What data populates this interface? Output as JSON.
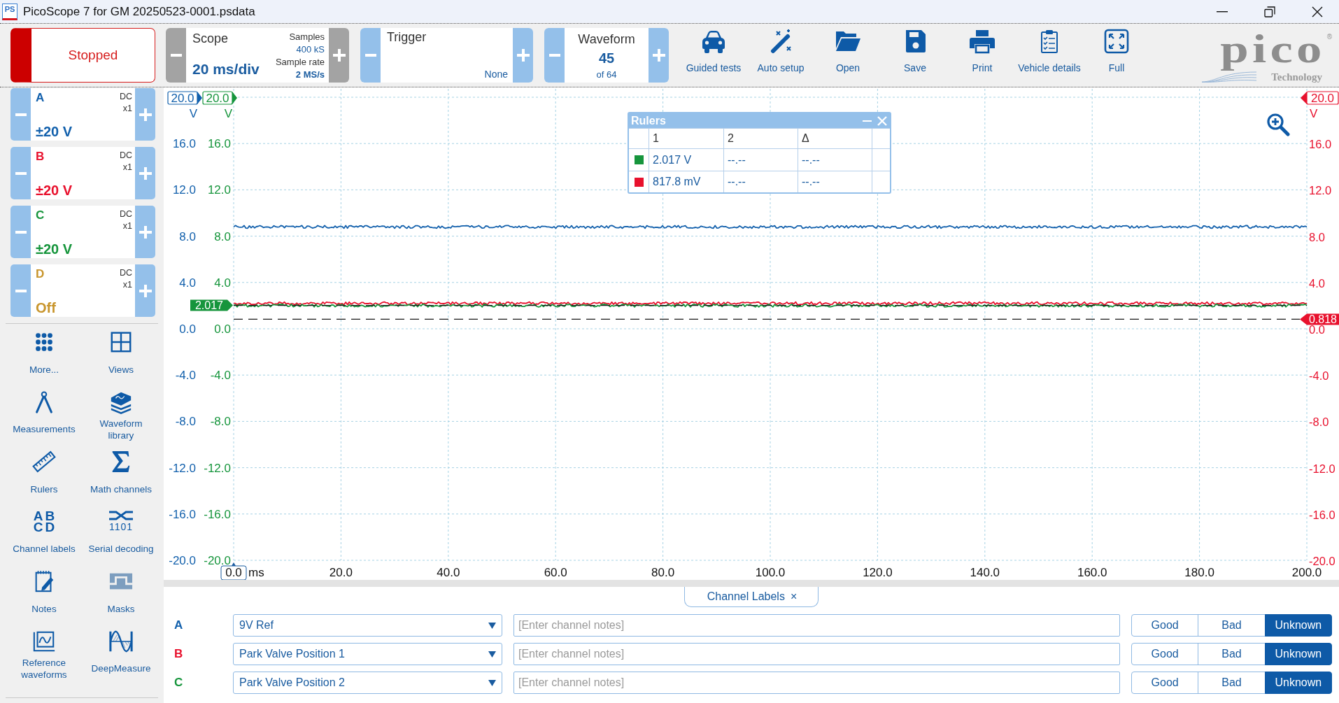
{
  "window": {
    "icon_letters": "PS",
    "title": "PicoScope 7 for GM 20250523-0001.psdata"
  },
  "toolbar": {
    "run_button": {
      "label": "Stopped",
      "running": false
    },
    "timebase": {
      "label": "Scope",
      "value": "20 ms/div",
      "samples_label": "Samples",
      "samples": "400 kS",
      "rate_label": "Sample rate",
      "rate": "2 MS/s"
    },
    "trigger": {
      "label": "Trigger",
      "mode": "None"
    },
    "waveform": {
      "label": "Waveform",
      "current": "45",
      "total": "of 64"
    },
    "buttons": [
      {
        "label": "Guided tests"
      },
      {
        "label": "Auto setup"
      },
      {
        "label": "Open"
      },
      {
        "label": "Save"
      },
      {
        "label": "Print"
      },
      {
        "label": "Vehicle details"
      },
      {
        "label": "Full"
      }
    ]
  },
  "logo": {
    "wordmark": "pico",
    "mark": "®",
    "tagline": "Technology"
  },
  "channels": [
    {
      "name": "A",
      "color": "#1260ac",
      "coupling": "DC",
      "probe": "x1",
      "range": "±20 V"
    },
    {
      "name": "B",
      "color": "#e8112d",
      "coupling": "DC",
      "probe": "x1",
      "range": "±20 V"
    },
    {
      "name": "C",
      "color": "#16953c",
      "coupling": "DC",
      "probe": "x1",
      "range": "±20 V"
    },
    {
      "name": "D",
      "color": "#c8952c",
      "coupling": "DC",
      "probe": "x1",
      "range": "Off"
    }
  ],
  "tools": [
    {
      "label": "More..."
    },
    {
      "label": "Views"
    },
    {
      "label": "Measurements"
    },
    {
      "label": "Waveform library"
    },
    {
      "label": "Rulers"
    },
    {
      "label": "Math channels"
    },
    {
      "label": "Channel labels",
      "glyph": [
        "AB",
        "CD"
      ]
    },
    {
      "label": "Serial decoding",
      "glyph": [
        "1101"
      ]
    },
    {
      "label": "Notes"
    },
    {
      "label": "Masks"
    },
    {
      "label": "Reference waveforms"
    },
    {
      "label": "DeepMeasure"
    }
  ],
  "chart": {
    "left_axes": [
      {
        "color": "#1260ac",
        "unit": "V"
      },
      {
        "color": "#16953c",
        "unit": "V",
        "tick_labels": [
          "20.0",
          "16.0",
          "12.0",
          "8.0",
          "4.0",
          "0.0",
          "-4.0",
          "-8.0",
          "-12.0",
          "-16.0",
          "-20.0"
        ]
      }
    ],
    "right_axes": [
      {
        "color": "#e8112d",
        "unit": "V",
        "tick_labels": [
          "20.0",
          "16.0",
          "12.0",
          "8.0",
          "4.0",
          "0.0",
          "-4.0",
          "-8.0",
          "-12.0",
          "-16.0",
          "-20.0"
        ]
      }
    ],
    "chart_data": {
      "type": "line",
      "x": [
        0,
        200
      ],
      "series": [
        {
          "color": "#1260ac",
          "values": [
            8.8,
            8.8
          ]
        },
        {
          "color": "#e8112d",
          "values": [
            2.2,
            2.2
          ]
        },
        {
          "color": "#16953c",
          "values": [
            2.0,
            2.0
          ]
        }
      ],
      "xlabel": "ms",
      "xlim": [
        0,
        200
      ],
      "ylim": [
        -20,
        20
      ],
      "grid": true,
      "xticks": [
        {
          "value": 0,
          "label": "0.0"
        },
        {
          "value": 20,
          "label": "20.0"
        },
        {
          "value": 40,
          "label": "40.0"
        },
        {
          "value": 60,
          "label": "60.0"
        },
        {
          "value": 80,
          "label": "80.0"
        },
        {
          "value": 100,
          "label": "100.0"
        },
        {
          "value": 120,
          "label": "120.0"
        },
        {
          "value": 140,
          "label": "140.0"
        },
        {
          "value": 160,
          "label": "160.0"
        },
        {
          "value": 180,
          "label": "180.0"
        },
        {
          "value": 200,
          "label": "200.0"
        }
      ],
      "yticks": [
        {
          "value": 20,
          "label": "20.0"
        },
        {
          "value": 16,
          "label": "16.0"
        },
        {
          "value": 12,
          "label": "12.0"
        },
        {
          "value": 8,
          "label": "8.0"
        },
        {
          "value": 4,
          "label": "4.0"
        },
        {
          "value": 0,
          "label": "0.0"
        },
        {
          "value": -4,
          "label": "-4.0"
        },
        {
          "value": -8,
          "label": "-8.0"
        },
        {
          "value": -12,
          "label": "-12.0"
        },
        {
          "value": -16,
          "label": "-16.0"
        },
        {
          "value": -20,
          "label": "-20.0"
        }
      ],
      "ref_lines": [
        {
          "axis": "y",
          "value": 2.017,
          "label": "2.017"
        },
        {
          "axis": "y",
          "value": 0.818,
          "label": "0.818"
        }
      ]
    }
  },
  "rulers": {
    "title": "Rulers",
    "columns": [
      "1",
      "2",
      "Δ"
    ],
    "rows": [
      {
        "color": "#16953c",
        "cells": [
          "2.017 V",
          "--.--",
          "--.--"
        ]
      },
      {
        "color": "#e8112d",
        "cells": [
          "817.8 mV",
          "--.--",
          "--.--"
        ]
      }
    ]
  },
  "channel_labels": {
    "tab": {
      "label": "Channel Labels",
      "close": "×"
    },
    "rows": [
      {
        "channel": "A",
        "color": "#1260ac",
        "label": "9V Ref",
        "placeholder": "[Enter channel notes]",
        "verdicts": [
          {
            "label": "Good",
            "selected": false
          },
          {
            "label": "Bad",
            "selected": false
          },
          {
            "label": "Unknown",
            "selected": true
          }
        ]
      },
      {
        "channel": "B",
        "color": "#e8112d",
        "label": "Park Valve Position 1",
        "placeholder": "[Enter channel notes]",
        "verdicts": [
          {
            "label": "Good",
            "selected": false
          },
          {
            "label": "Bad",
            "selected": false
          },
          {
            "label": "Unknown",
            "selected": true
          }
        ]
      },
      {
        "channel": "C",
        "color": "#16953c",
        "label": "Park Valve Position 2",
        "placeholder": "[Enter channel notes]",
        "verdicts": [
          {
            "label": "Good",
            "selected": false
          },
          {
            "label": "Bad",
            "selected": false
          },
          {
            "label": "Unknown",
            "selected": true
          }
        ]
      }
    ]
  }
}
